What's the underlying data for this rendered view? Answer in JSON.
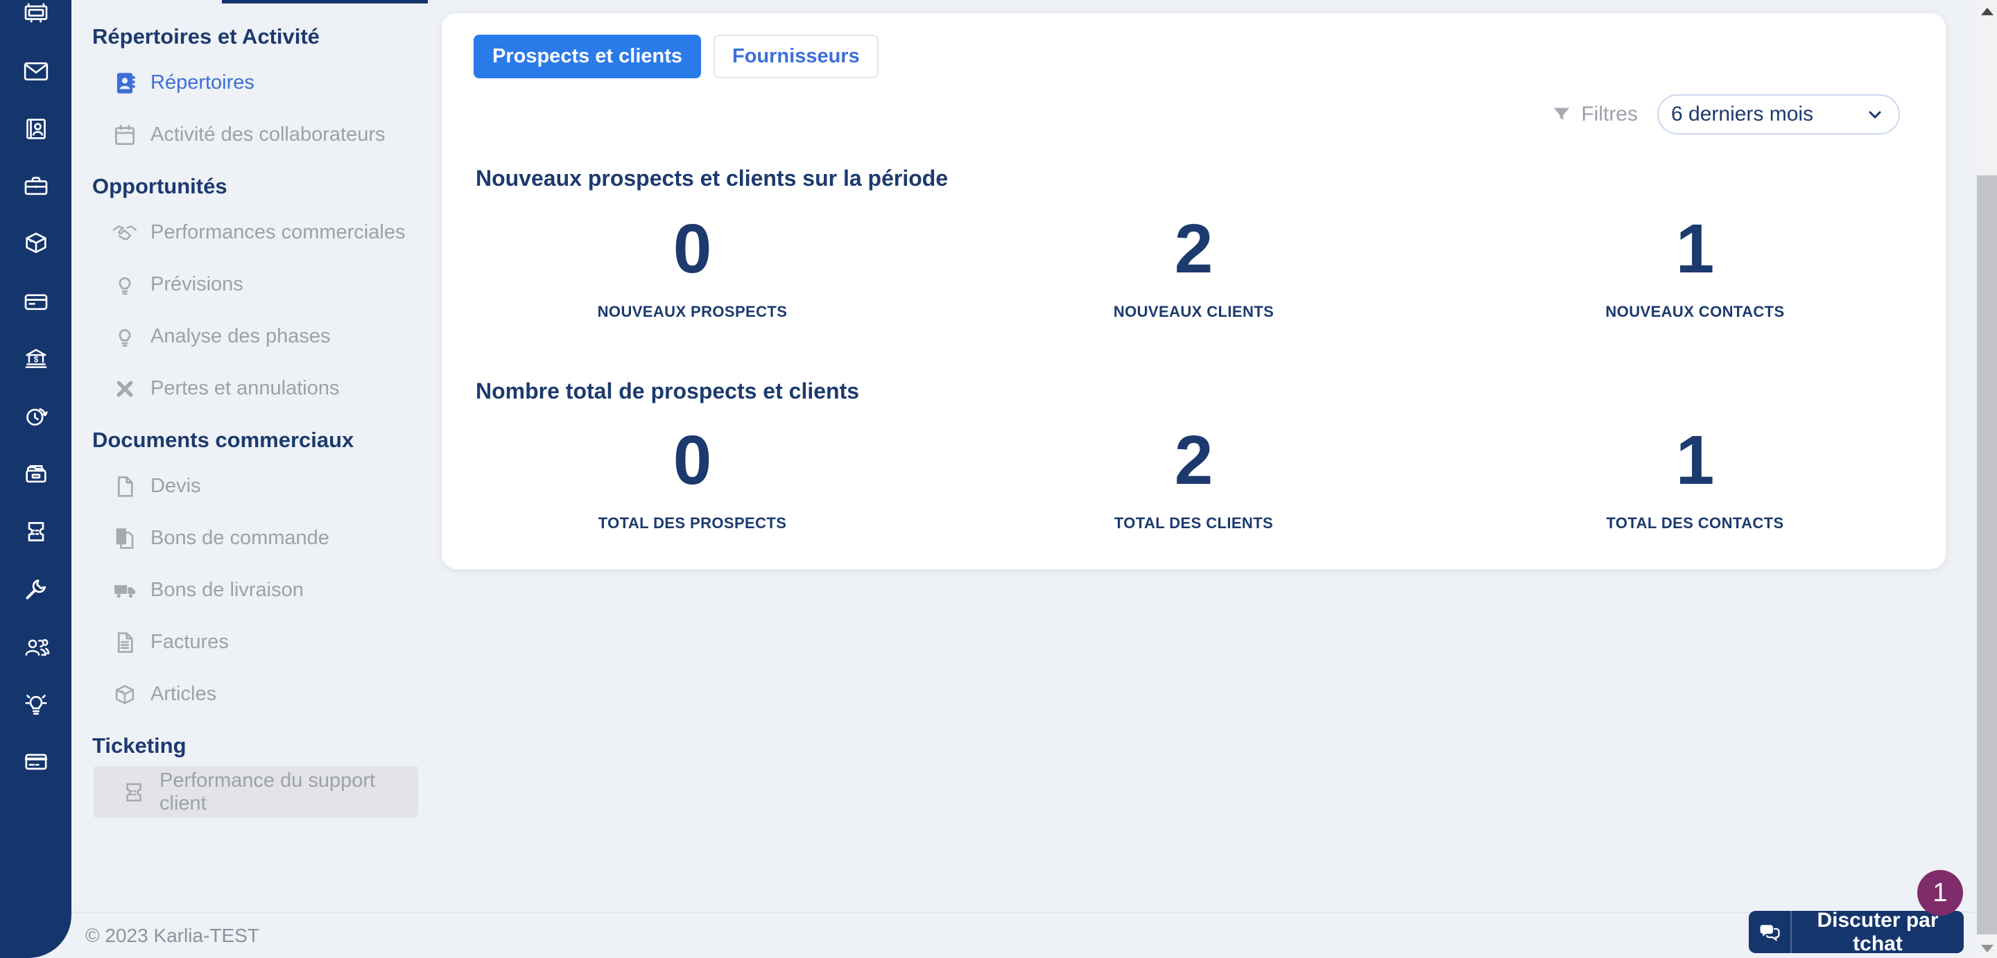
{
  "app": {
    "copyright": "© 2023 Karlia-TEST"
  },
  "colors": {
    "sidebar_navy": "#15356d",
    "accent_blue": "#2b7ae9",
    "link_blue": "#3d6fd7",
    "text_navy": "#1c3a6e",
    "badge_purple": "#7e2c6a",
    "muted_gray": "#9da1a8"
  },
  "iconbar": {
    "items": [
      "dashboard",
      "mail",
      "contacts",
      "projects",
      "package",
      "payments",
      "bank",
      "time-tracking",
      "archive",
      "tickets",
      "tools",
      "team",
      "ideas",
      "subscriptions"
    ]
  },
  "sidebar": {
    "sections": [
      {
        "title": "Répertoires et Activité",
        "items": [
          {
            "label": "Répertoires",
            "icon": "address-book",
            "state": "active"
          },
          {
            "label": "Activité des collaborateurs",
            "icon": "calendar"
          }
        ]
      },
      {
        "title": "Opportunités",
        "items": [
          {
            "label": "Performances commerciales",
            "icon": "handshake"
          },
          {
            "label": "Prévisions",
            "icon": "lightbulb"
          },
          {
            "label": "Analyse des phases",
            "icon": "lightbulb"
          },
          {
            "label": "Pertes et annulations",
            "icon": "cross"
          }
        ]
      },
      {
        "title": "Documents commerciaux",
        "items": [
          {
            "label": "Devis",
            "icon": "file"
          },
          {
            "label": "Bons de commande",
            "icon": "file-copy"
          },
          {
            "label": "Bons de livraison",
            "icon": "truck"
          },
          {
            "label": "Factures",
            "icon": "file-lines"
          },
          {
            "label": "Articles",
            "icon": "box"
          }
        ]
      },
      {
        "title": "Ticketing",
        "items": [
          {
            "label": "Performance du support client",
            "icon": "ticket",
            "state": "highlight"
          }
        ]
      }
    ]
  },
  "main": {
    "tabs": [
      {
        "label": "Prospects et clients",
        "active": true
      },
      {
        "label": "Fournisseurs",
        "active": false
      }
    ],
    "filters": {
      "label": "Filtres",
      "selected_period": "6 derniers mois"
    },
    "sections": [
      {
        "title": "Nouveaux prospects et clients sur la période",
        "stats": [
          {
            "value": "0",
            "label": "NOUVEAUX PROSPECTS"
          },
          {
            "value": "2",
            "label": "NOUVEAUX CLIENTS"
          },
          {
            "value": "1",
            "label": "NOUVEAUX CONTACTS"
          }
        ]
      },
      {
        "title": "Nombre total de prospects et clients",
        "stats": [
          {
            "value": "0",
            "label": "TOTAL DES PROSPECTS"
          },
          {
            "value": "2",
            "label": "TOTAL DES CLIENTS"
          },
          {
            "value": "1",
            "label": "TOTAL DES CONTACTS"
          }
        ]
      }
    ]
  },
  "chat": {
    "label": "Discuter par tchat",
    "badge": "1"
  }
}
